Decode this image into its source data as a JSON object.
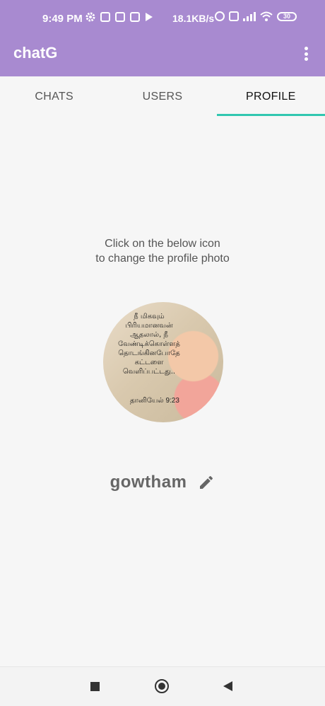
{
  "status_bar": {
    "time": "9:49 PM",
    "net_speed": "18.1KB/s",
    "battery": "30",
    "icons": [
      "settings-icon",
      "upload-icon",
      "instagram-icon",
      "instagram-icon",
      "play-icon",
      "alarm-icon",
      "volte-icon",
      "signal-icon",
      "wifi-icon",
      "battery-icon"
    ]
  },
  "app_bar": {
    "title": "chatG",
    "menu_icon": "more-vert-icon",
    "color": "#a88ad0"
  },
  "tabs": [
    {
      "label": "CHATS",
      "active": false
    },
    {
      "label": "USERS",
      "active": false
    },
    {
      "label": "PROFILE",
      "active": true
    }
  ],
  "accent_color": "#31c7b0",
  "profile": {
    "hint_line1": "Click on the below icon",
    "hint_line2": "to change the profile photo",
    "photo_text": "நீ மிகவும் பிரியமானவன் ஆதலால், நீ வேண்டிக்கொள்ளத் தொடங்கினபோதே கட்டளை வெளிப்பட்டது..",
    "photo_verse": "தானியேல் 9:23",
    "name": "gowtham",
    "edit_icon": "pencil-icon"
  },
  "nav_bar": {
    "icons": [
      "recents-icon",
      "home-icon",
      "back-icon"
    ]
  }
}
